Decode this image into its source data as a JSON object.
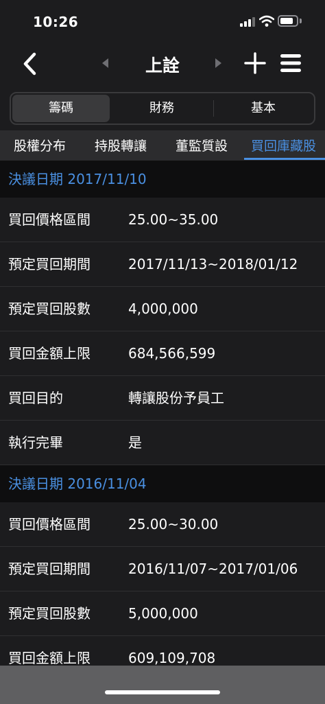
{
  "status": {
    "time": "10:26"
  },
  "nav": {
    "title": "上詮"
  },
  "segments": [
    {
      "label": "籌碼"
    },
    {
      "label": "財務"
    },
    {
      "label": "基本"
    }
  ],
  "tabs": [
    {
      "label": "股權分布"
    },
    {
      "label": "持股轉讓"
    },
    {
      "label": "董監質設"
    },
    {
      "label": "買回庫藏股"
    }
  ],
  "sections": [
    {
      "header": "決議日期 2017/11/10",
      "rows": [
        {
          "label": "買回價格區間",
          "value": "25.00~35.00"
        },
        {
          "label": "預定買回期間",
          "value": "2017/11/13~2018/01/12"
        },
        {
          "label": "預定買回股數",
          "value": "4,000,000"
        },
        {
          "label": "買回金額上限",
          "value": "684,566,599"
        },
        {
          "label": "買回目的",
          "value": "轉讓股份予員工"
        },
        {
          "label": "執行完畢",
          "value": "是"
        }
      ]
    },
    {
      "header": "決議日期 2016/11/04",
      "rows": [
        {
          "label": "買回價格區間",
          "value": "25.00~30.00"
        },
        {
          "label": "預定買回期間",
          "value": "2016/11/07~2017/01/06"
        },
        {
          "label": "預定買回股數",
          "value": "5,000,000"
        },
        {
          "label": "買回金額上限",
          "value": "609,109,708"
        }
      ]
    }
  ],
  "colors": {
    "accent": "#4a90e2",
    "background": "#1c1c1e",
    "section_background": "#0e0e0f",
    "tab_background": "#2c2c2e"
  },
  "icons": {
    "back": "chevron-left-icon",
    "prev": "triangle-left-icon",
    "next": "triangle-right-icon",
    "add": "plus-icon",
    "menu": "hamburger-menu-icon"
  }
}
